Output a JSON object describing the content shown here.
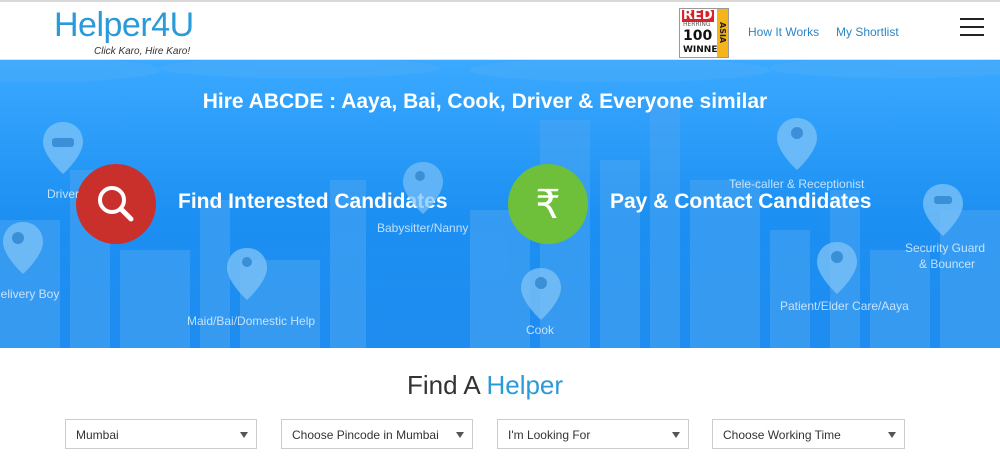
{
  "header": {
    "logo_text": "Helper4U",
    "logo_tagline": "Click Karo, Hire Karo!",
    "badge": {
      "line1": "RED",
      "line2": "HERRING",
      "line3": "100",
      "line4": "WINNER",
      "side": "ASIA"
    },
    "nav": [
      "How It Works",
      "My Shortlist"
    ],
    "menu_icon": "hamburger-menu-icon"
  },
  "hero": {
    "title": "Hire ABCDE : Aaya, Bai, Cook, Driver & Everyone similar",
    "features": [
      {
        "label": "Find Interested Candidates",
        "icon": "search-icon",
        "color": "#d0342c"
      },
      {
        "label": "Pay & Contact Candidates",
        "icon": "rupee-icon",
        "color": "#72c23a"
      }
    ],
    "categories": [
      "Driver",
      "Delivery Boy",
      "Maid/Bai/Domestic Help",
      "Babysitter/Nanny",
      "Cook",
      "Tele-caller & Receptionist",
      "Security Guard",
      "& Bouncer",
      "Patient/Elder Care/Aaya"
    ]
  },
  "find": {
    "title_part1": "Find A ",
    "title_part2": "Helper",
    "selects": [
      "Mumbai",
      "Choose Pincode in Mumbai",
      "I'm Looking For",
      "Choose Working Time"
    ]
  },
  "colors": {
    "brand": "#2a9ad8",
    "hero": "#1f8cf0"
  }
}
